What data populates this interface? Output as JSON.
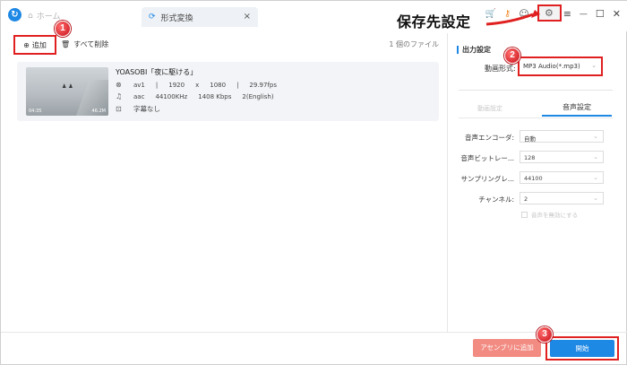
{
  "titlebar": {
    "home_label": "ホーム",
    "active_tab_label": "形式変換",
    "close_glyph": "×",
    "min_glyph": "—",
    "max_glyph": "☐",
    "exit_glyph": "✕",
    "menu_glyph": "≡"
  },
  "toolbar": {
    "add_label": "追加",
    "clear_label": "すべて削除",
    "file_count": "1 個のファイル"
  },
  "file": {
    "title": "YOASOBI「夜に駆ける」",
    "video_codec": "av1",
    "width": "1920",
    "x": "x",
    "height": "1080",
    "sep": "|",
    "fps": "29.97fps",
    "audio_codec": "aac",
    "sample_rate": "44100KHz",
    "bitrate": "1408 Kbps",
    "channels": "2(English)",
    "subtitle": "字幕なし",
    "duration": "04:35",
    "size": "46.2M"
  },
  "panel": {
    "output_title": "出力設定",
    "format_label": "動画形式:",
    "format_value": "MP3 Audio(*.mp3)",
    "video_tab": "動画設定",
    "audio_tab": "音声設定",
    "encoder_label": "音声エンコーダ:",
    "encoder_value": "自動",
    "bitrate_label": "音声ビットレー...",
    "bitrate_value": "128",
    "samplerate_label": "サンプリングレ...",
    "samplerate_value": "44100",
    "channel_label": "チャンネル:",
    "channel_value": "2",
    "checkbox_label": "音声を無効にする"
  },
  "footer": {
    "assembly_label": "アセンブリに追加",
    "start_label": "開始"
  },
  "annotations": {
    "callout": "保存先設定",
    "badge1": "1",
    "badge2": "2",
    "badge3": "3"
  },
  "colors": {
    "accent": "#1e88e5",
    "annotation_red": "#e02020",
    "assembly_button": "#f28b82"
  }
}
